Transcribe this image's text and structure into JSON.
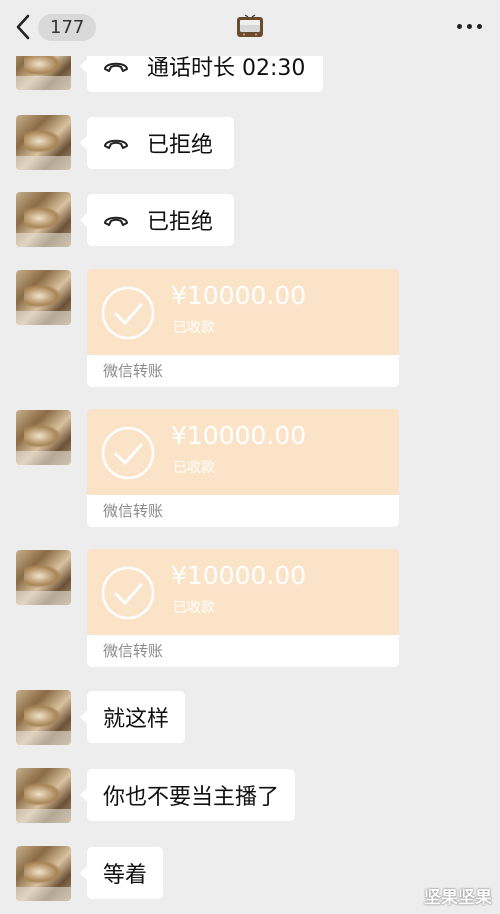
{
  "header": {
    "unread_count": "177",
    "back_icon": "chevron-left-icon",
    "title_icon": "tv-icon",
    "more_icon": "more-dots-icon"
  },
  "messages": [
    {
      "type": "call",
      "icon": "phone-hangup-icon",
      "text": "通话时长 02:30"
    },
    {
      "type": "call",
      "icon": "phone-hangup-icon",
      "text": "已拒绝"
    },
    {
      "type": "call",
      "icon": "phone-hangup-icon",
      "text": "已拒绝"
    },
    {
      "type": "transfer",
      "amount": "¥10000.00",
      "status": "已收款",
      "label": "微信转账"
    },
    {
      "type": "transfer",
      "amount": "¥10000.00",
      "status": "已收款",
      "label": "微信转账"
    },
    {
      "type": "transfer",
      "amount": "¥10000.00",
      "status": "已收款",
      "label": "微信转账"
    },
    {
      "type": "text",
      "text": "就这样"
    },
    {
      "type": "text",
      "text": "你也不要当主播了"
    },
    {
      "type": "text",
      "text": "等着"
    }
  ],
  "watermark": "坚果坚果",
  "colors": {
    "background": "#ededed",
    "bubble": "#ffffff",
    "transfer_received": "#fbe3c8"
  }
}
